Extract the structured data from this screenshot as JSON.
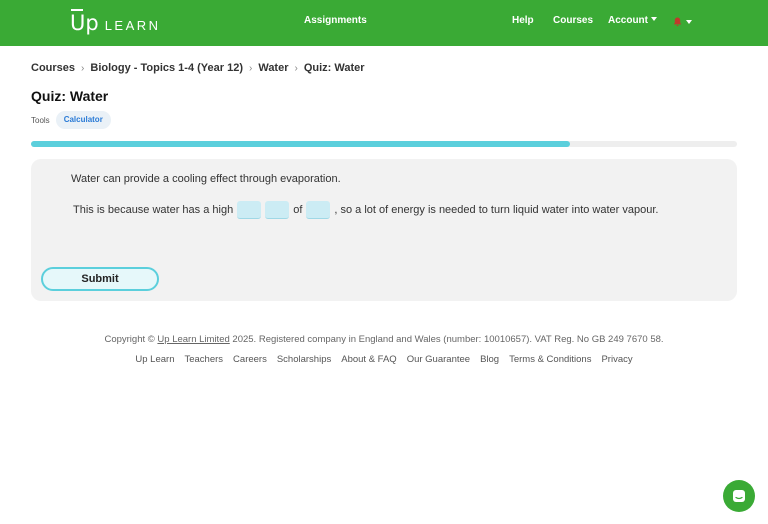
{
  "header": {
    "logo_up": "Up",
    "logo_learn": "LEARN",
    "nav": {
      "assignments": "Assignments",
      "help": "Help",
      "courses": "Courses",
      "account": "Account"
    },
    "bell_color": "#c0392b",
    "brand_color": "#3aaa35"
  },
  "breadcrumb": [
    "Courses",
    "Biology - Topics 1-4 (Year 12)",
    "Water",
    "Quiz: Water"
  ],
  "page_title": "Quiz: Water",
  "tools": {
    "label": "Tools",
    "calculator": "Calculator"
  },
  "progress": {
    "fraction": 0.764
  },
  "question": {
    "line1": "Water can provide a cooling effect through evaporation.",
    "part_a": "This is because water has a high",
    "part_of": "of",
    "part_b": ", so a lot of energy is needed to turn liquid water into water vapour.",
    "blanks": [
      "",
      "",
      ""
    ],
    "submit": "Submit"
  },
  "footer": {
    "copyright_prefix": "Copyright ©",
    "company": "Up Learn Limited",
    "copyright_suffix": "2025. Registered company in England and Wales (number: 10010657). VAT Reg. No GB 249 7670 58.",
    "links": [
      "Up Learn",
      "Teachers",
      "Careers",
      "Scholarships",
      "About & FAQ",
      "Our Guarantee",
      "Blog",
      "Terms & Conditions",
      "Privacy"
    ]
  },
  "icons": {
    "bell": "bell-icon",
    "chat": "chat-icon",
    "chevron": "chevron-right-icon"
  }
}
